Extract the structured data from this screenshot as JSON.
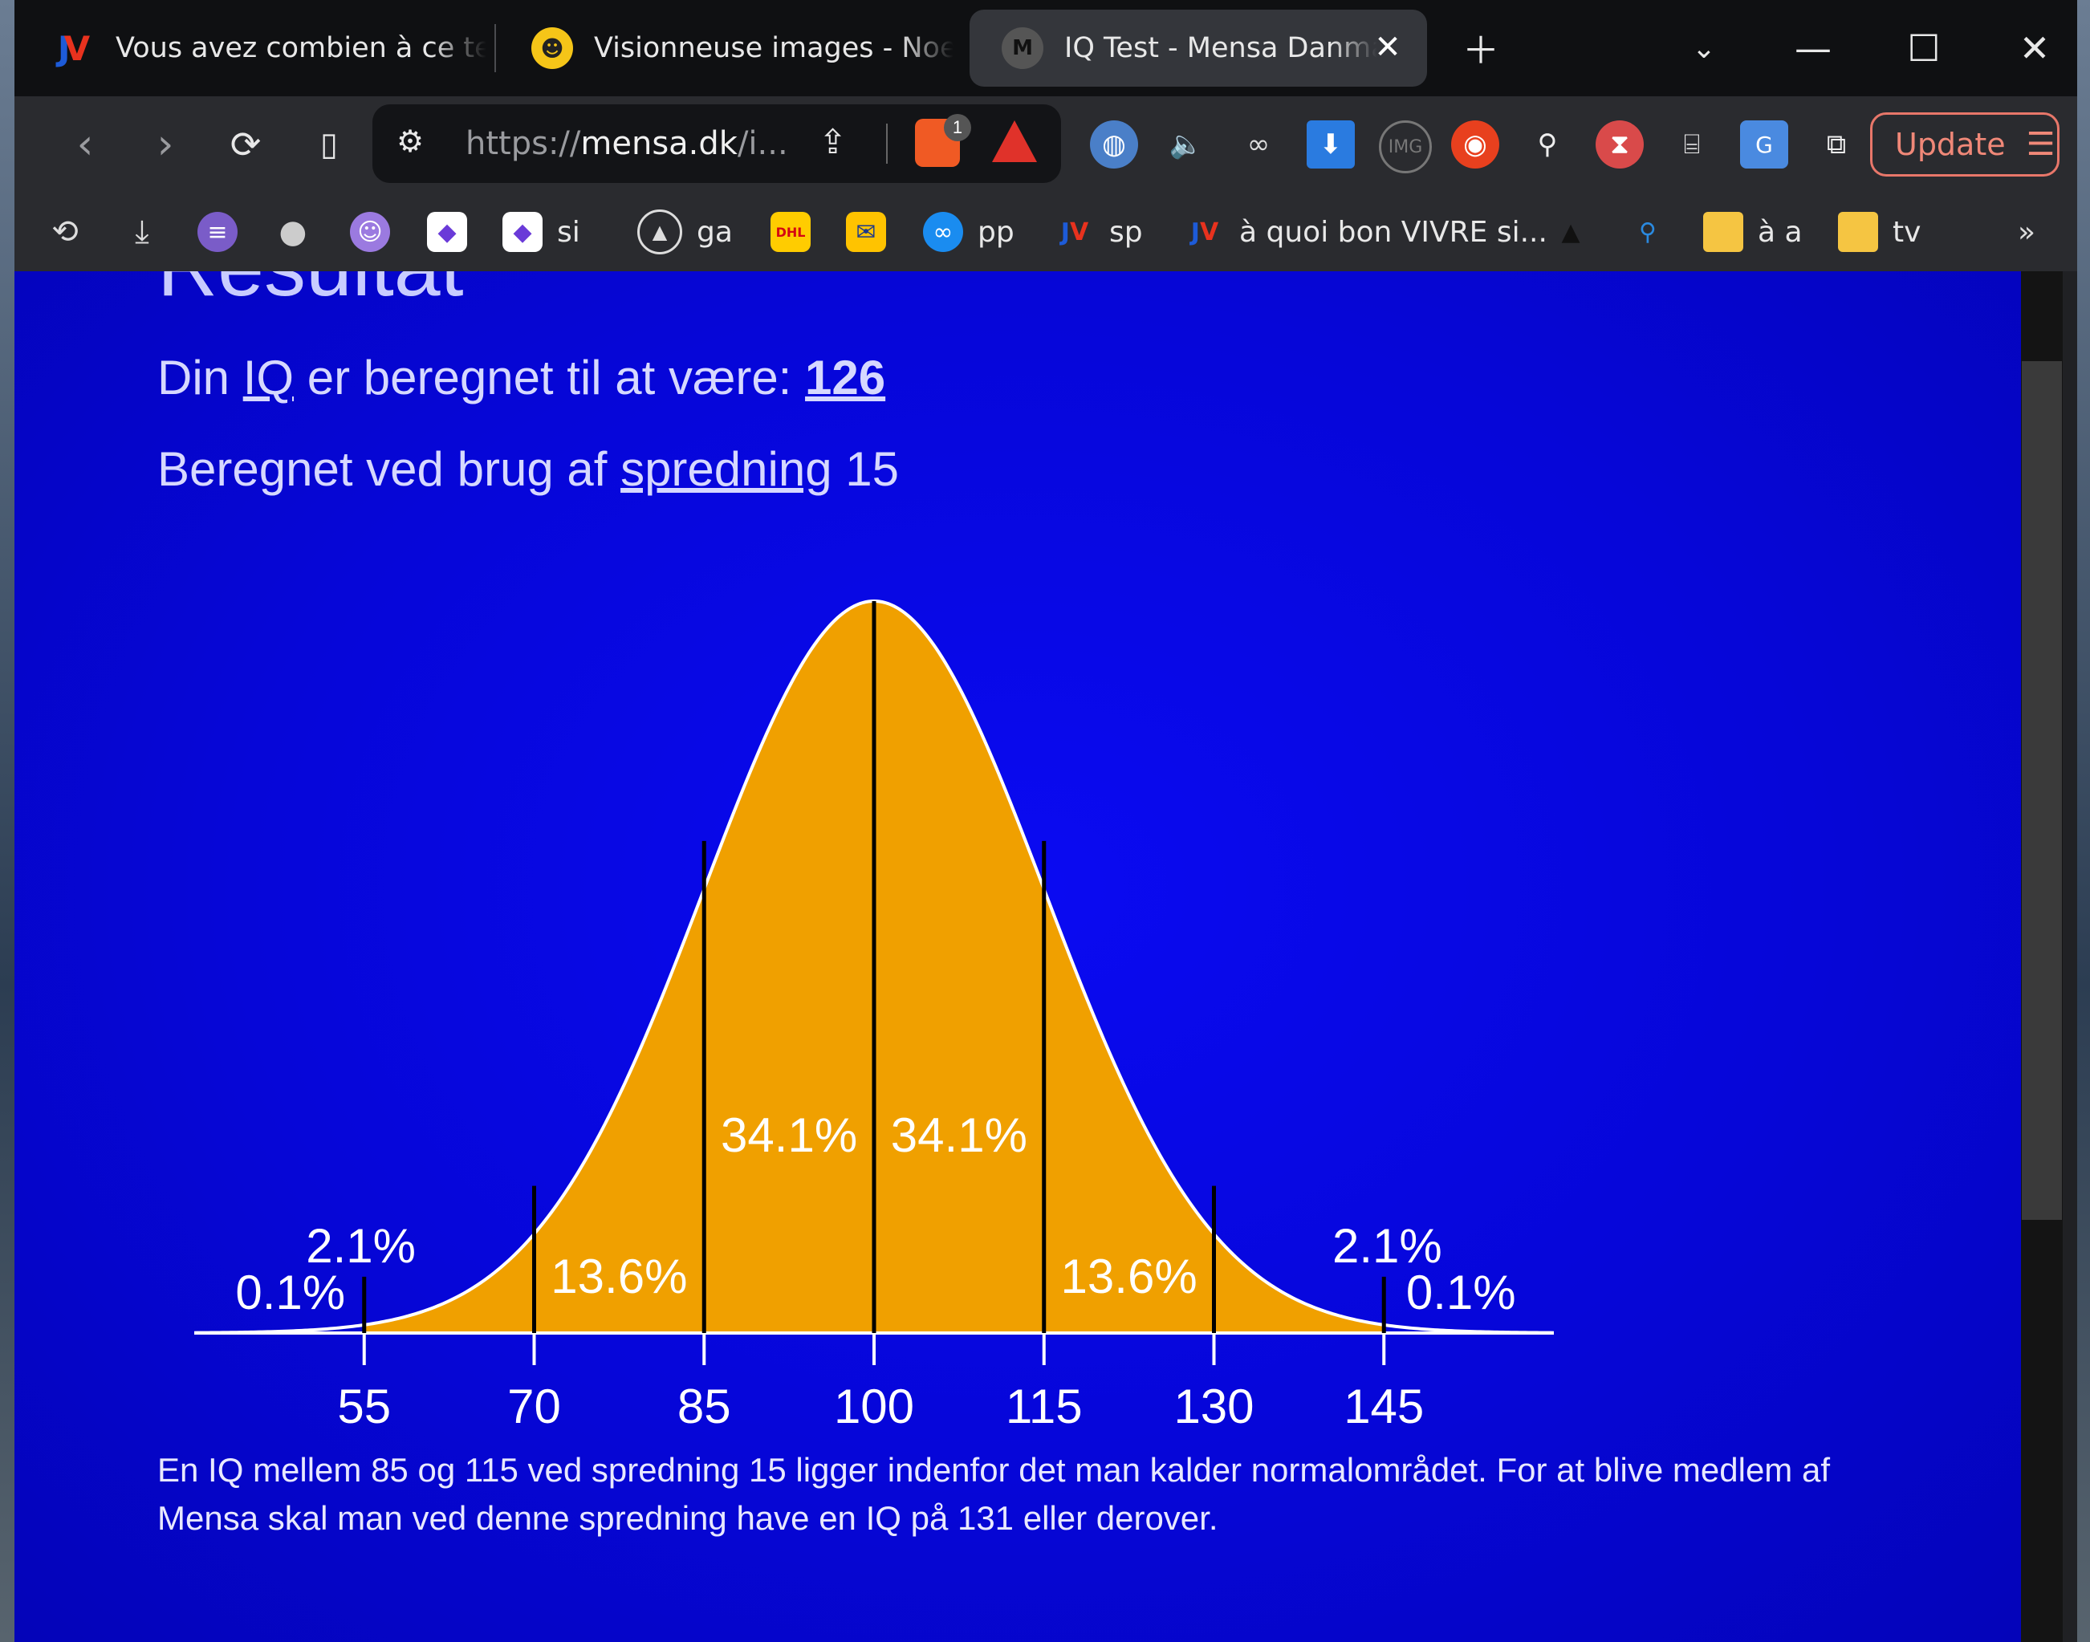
{
  "tabs": [
    {
      "label": "Vous avez combien à ce test",
      "favicon": "jv-icon"
    },
    {
      "label": "Visionneuse images - Noelshack",
      "favicon": "noelshack-icon"
    },
    {
      "label": "IQ Test - Mensa Danmark",
      "favicon": "mensa-icon"
    }
  ],
  "url": {
    "prefix": "https://",
    "host": "mensa.dk",
    "rest": "/i..."
  },
  "brave_badge": "1",
  "update_label": "Update",
  "bookmarks": [
    "si",
    "ga",
    "pp",
    "sp",
    "à quoi bon VIVRE si...",
    "à a",
    "tv"
  ],
  "page": {
    "heading": "Resultat",
    "iq_prefix": "Din",
    "iq_link": "IQ",
    "iq_middle": "er beregnet til at være:",
    "iq_value": "126",
    "sd_prefix": "Beregnet ved brug af",
    "sd_link": "spredning",
    "sd_value": "15",
    "footer": "En IQ mellem 85 og 115 ved spredning 15 ligger indenfor det man kalder normalområdet. For at blive medlem af Mensa skal man ved denne spredning have en IQ på 131 eller derover."
  },
  "chart_data": {
    "type": "area",
    "distribution": "normal",
    "mean": 100,
    "sd": 15,
    "x_ticks": [
      55,
      70,
      85,
      100,
      115,
      130,
      145
    ],
    "segments": [
      {
        "from": 40,
        "to": 55,
        "percent": "0.1%"
      },
      {
        "from": 55,
        "to": 70,
        "percent": "2.1%"
      },
      {
        "from": 70,
        "to": 85,
        "percent": "13.6%"
      },
      {
        "from": 85,
        "to": 100,
        "percent": "34.1%"
      },
      {
        "from": 100,
        "to": 115,
        "percent": "34.1%"
      },
      {
        "from": 115,
        "to": 130,
        "percent": "13.6%"
      },
      {
        "from": 130,
        "to": 145,
        "percent": "2.1%"
      },
      {
        "from": 145,
        "to": 160,
        "percent": "0.1%"
      }
    ],
    "fill_color": "#f0a000",
    "background_color": "#0606d8",
    "title": "",
    "xlabel": "",
    "ylabel": ""
  }
}
